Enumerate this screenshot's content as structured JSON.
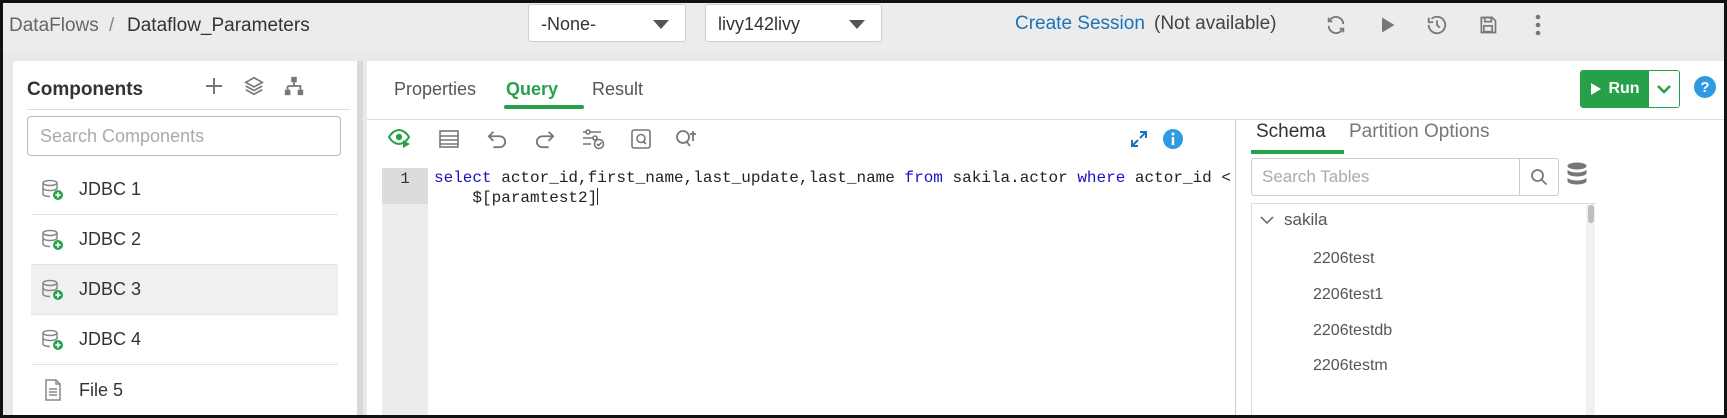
{
  "breadcrumb": {
    "root": "DataFlows",
    "separator": "/",
    "current": "Dataflow_Parameters"
  },
  "header": {
    "select_none": "-None-",
    "select_livy": "livy142livy",
    "create_session": "Create Session",
    "session_status": "(Not available)",
    "icons": [
      "refresh-icon",
      "play-icon",
      "history-icon",
      "save-icon",
      "more-vert-icon"
    ]
  },
  "left_panel": {
    "title": "Components",
    "search_placeholder": "Search Components",
    "items": [
      {
        "label": "JDBC 1",
        "icon": "database-add-icon"
      },
      {
        "label": "JDBC 2",
        "icon": "database-add-icon"
      },
      {
        "label": "JDBC 3",
        "icon": "database-add-icon",
        "selected": true
      },
      {
        "label": "JDBC 4",
        "icon": "database-add-icon"
      },
      {
        "label": "File 5",
        "icon": "file-icon"
      }
    ]
  },
  "main": {
    "tabs": [
      "Properties",
      "Query",
      "Result"
    ],
    "active_tab": "Query",
    "run_label": "Run",
    "help": "?"
  },
  "editor": {
    "line_number": "1",
    "code_line1_parts": {
      "kw_select": "select",
      "cols": " actor_id,first_name,last_update,last_name ",
      "kw_from": "from",
      "table": " sakila.actor ",
      "kw_where": "where",
      "cond": " actor_id <"
    },
    "code_line2": "    $[paramtest2]"
  },
  "schema": {
    "tabs": [
      "Schema",
      "Partition Options"
    ],
    "active_tab": "Schema",
    "search_placeholder": "Search Tables",
    "database": "sakila",
    "tables": [
      "2206test",
      "2206test1",
      "2206testdb",
      "2206testm"
    ]
  },
  "colors": {
    "accent_green": "#27a149",
    "link_blue": "#1a73b8",
    "keyword_blue": "#1c10c4",
    "info_blue": "#2e9be0"
  }
}
